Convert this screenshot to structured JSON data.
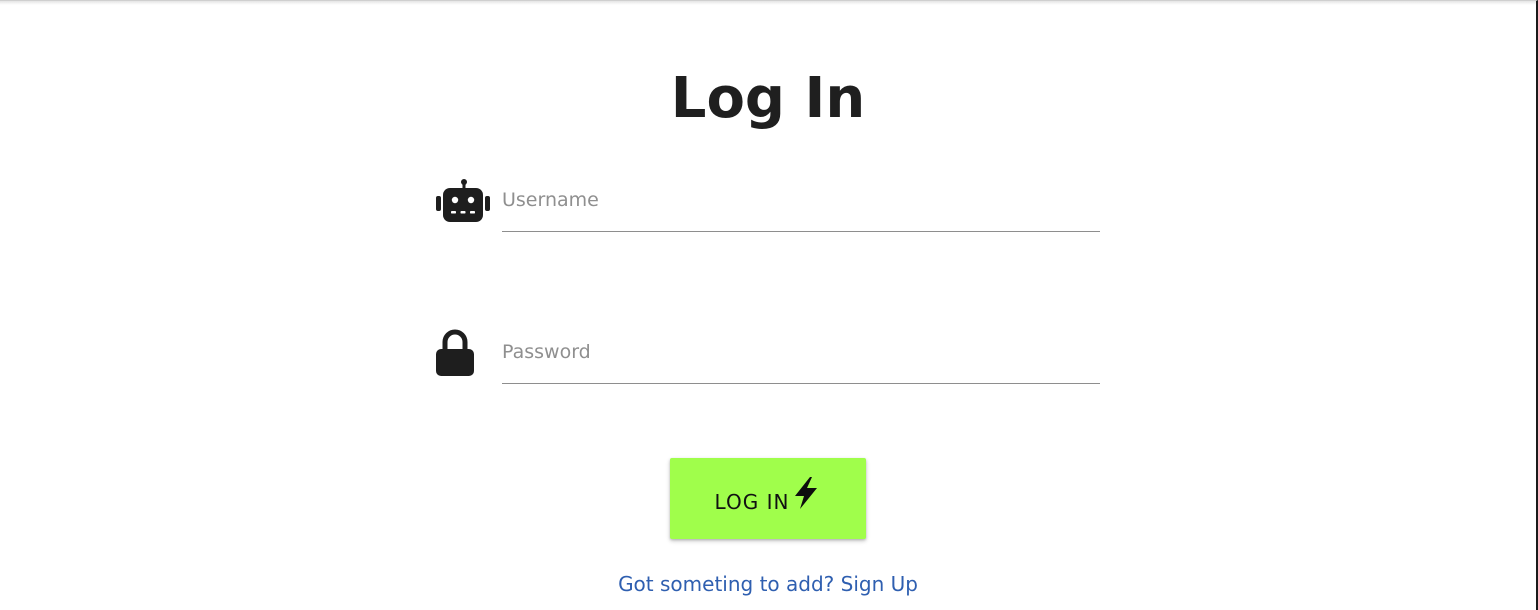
{
  "page": {
    "title": "Log In"
  },
  "form": {
    "username": {
      "icon": "robot-icon",
      "placeholder": "Username",
      "value": ""
    },
    "password": {
      "icon": "lock-icon",
      "placeholder": "Password",
      "value": ""
    },
    "submit": {
      "label": "LOG IN",
      "icon": "lightning-bolt-icon",
      "color": "#a0fe4b"
    }
  },
  "signup": {
    "label": "Got someting to add? Sign Up",
    "color": "#2f5fb0"
  }
}
